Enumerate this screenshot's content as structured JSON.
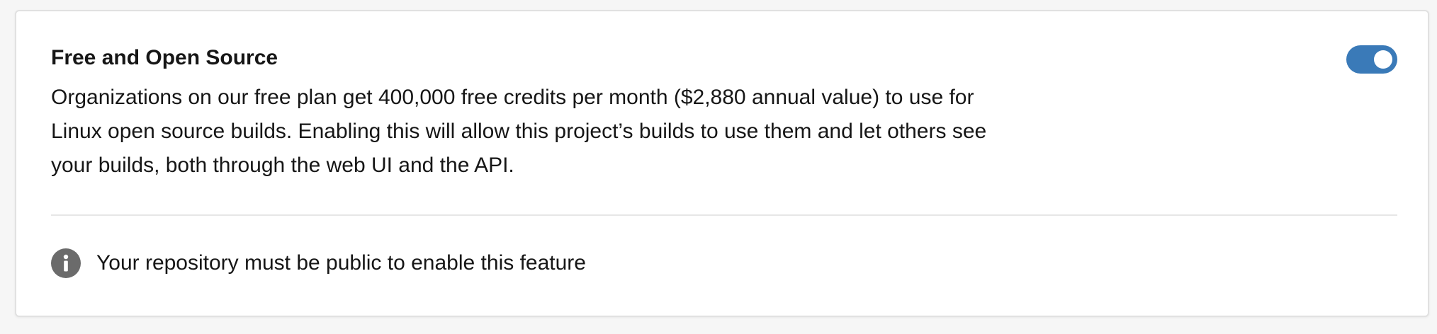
{
  "setting": {
    "title": "Free and Open Source",
    "description": "Organizations on our free plan get 400,000 free credits per month ($2,880 annual value) to use for Linux open source builds. Enabling this will allow this project’s builds to use them and let others see your builds, both through the web UI and the API.",
    "toggle_enabled": true,
    "toggle_color": "#3a7ab8"
  },
  "notice": {
    "icon": "info-icon",
    "text": "Your repository must be public to enable this feature",
    "icon_color": "#6b6b6b"
  }
}
